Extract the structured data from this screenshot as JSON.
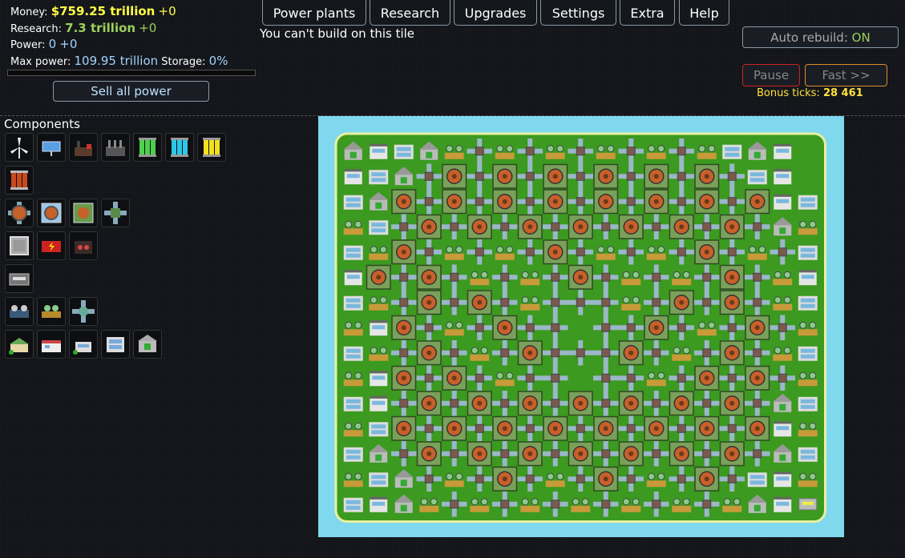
{
  "stats": {
    "money_label": "Money:",
    "money_value": "$759.25 trillion",
    "money_delta": "+0",
    "research_label": "Research:",
    "research_value": "7.3 trillion",
    "research_delta": "+0",
    "power_label": "Power:",
    "power_value": "0",
    "power_delta": "+0",
    "maxpower_label": "Max power:",
    "maxpower_value": "109.95 trillion",
    "storage_label": "Storage:",
    "storage_value": "0%"
  },
  "sell_all_label": "Sell all power",
  "nav": [
    "Power plants",
    "Research",
    "Upgrades",
    "Settings",
    "Extra",
    "Help"
  ],
  "message": "You can't build on this tile",
  "auto_rebuild_label": "Auto rebuild:",
  "auto_rebuild_value": "ON",
  "pause_label": "Pause",
  "fast_label": "Fast >>",
  "bonus_label": "Bonus ticks:",
  "bonus_value": "28 461",
  "components_title": "Components",
  "components": [
    [
      "wind-turbine-icon",
      "solar-panel-icon",
      "coal-plant-icon",
      "gas-plant-icon",
      "green-cell-icon",
      "cyan-cell-icon",
      "yellow-cell-icon"
    ],
    [
      "red-cell-icon"
    ],
    [
      "heat-exchanger-icon",
      "heat-vent-icon",
      "cooling-box-icon",
      "pipe-junction-icon"
    ],
    [
      "steel-plate-icon",
      "battery-icon",
      "boiler-icon"
    ],
    [
      "transformer-icon"
    ],
    [
      "generator-icon",
      "research-lab-icon",
      "big-pipe-junction-icon"
    ],
    [
      "small-office-icon",
      "shop-icon",
      "house-icon",
      "apartment-icon",
      "bank-icon"
    ]
  ],
  "grid": {
    "rows": 15,
    "cols": 19,
    "tiles": [
      "ABCASPSPSPSPSPSCAB",
      "BCAPVPVPVPVPVPVPCB",
      "CAVPVPVPVPVPVPVPVBC",
      "SCPVPVPVPVPVPVPVPAS",
      "CSVPSPSPVPSPSPVPSPC",
      "BVPVPSPSPVPSPSPVPSB",
      "CSPVPVPSPPPSPVPVPSC",
      "SBVPSPVPPGPPVPSPVPS",
      "CSPVPSPVPPPVPSPVPSC",
      "SBVPVPSPPGPPSPVPVPS",
      "CBPVPVPVPVPVPVPVPAC",
      "SCVPVPVPVPVPVPVPVBS",
      "CAPVPVPVPVPVPVPVPAC",
      "SCAPSPVPSPVPSPVPCBS",
      "CBASPSPSPSPSPSPSABT"
    ]
  },
  "colors": {
    "money": "#ffff44",
    "research": "#9bd15a",
    "power": "#9fd3ff",
    "water": "#7fd8ee",
    "grass": "#3b9a1f",
    "pause_border": "#cc2222",
    "fast_border": "#e08a2a"
  }
}
